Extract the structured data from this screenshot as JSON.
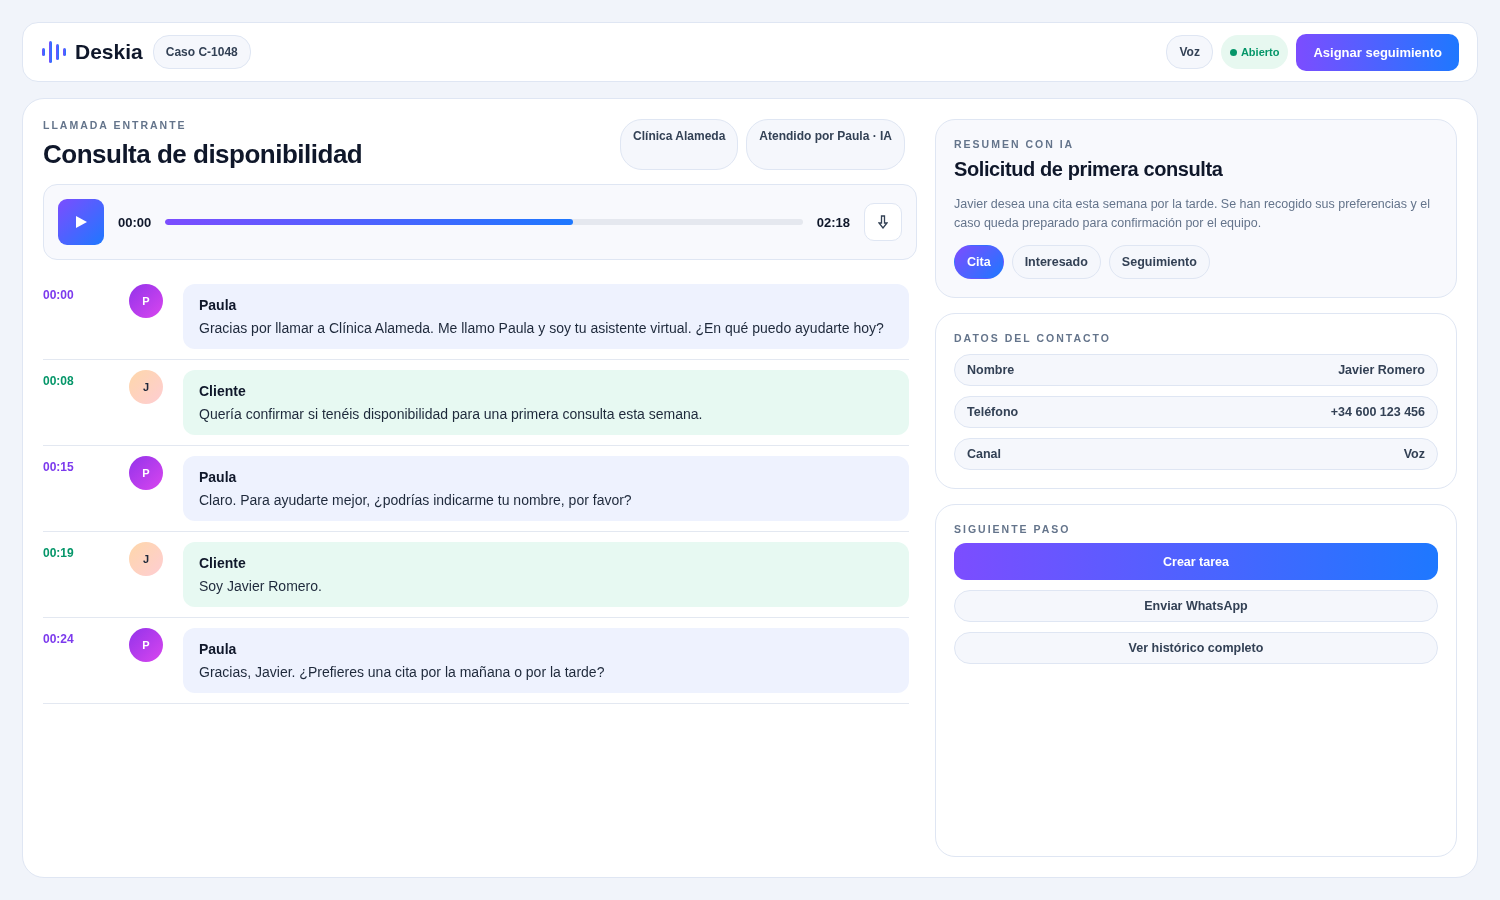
{
  "header": {
    "brand": "Deskia",
    "case": "Caso C-1048",
    "channel": "Voz",
    "status": {
      "label": "Abierto",
      "color": "#059669"
    },
    "primary_button": "Asignar seguimiento"
  },
  "call": {
    "eyebrow": "LLAMADA ENTRANTE",
    "title": "Consulta de disponibilidad",
    "chips": [
      "Clínica Alameda",
      "Atendido por Paula · IA"
    ],
    "player": {
      "current": "00:00",
      "duration": "02:18",
      "level": 0.64
    },
    "transcript": [
      {
        "time": "00:00",
        "kind": "agent",
        "initial": "P",
        "speaker": "Paula",
        "text": "Gracias por llamar a Clínica Alameda. Me llamo Paula y soy tu asistente virtual. ¿En qué puedo ayudarte hoy?"
      },
      {
        "time": "00:08",
        "kind": "client",
        "initial": "J",
        "speaker": "Cliente",
        "text": "Quería confirmar si tenéis disponibilidad para una primera consulta esta semana."
      },
      {
        "time": "00:15",
        "kind": "agent",
        "initial": "P",
        "speaker": "Paula",
        "text": "Claro. Para ayudarte mejor, ¿podrías indicarme tu nombre, por favor?"
      },
      {
        "time": "00:19",
        "kind": "client",
        "initial": "J",
        "speaker": "Cliente",
        "text": "Soy Javier Romero."
      },
      {
        "time": "00:24",
        "kind": "agent",
        "initial": "P",
        "speaker": "Paula",
        "text": "Gracias, Javier. ¿Prefieres una cita por la mañana o por la tarde?"
      }
    ]
  },
  "summary": {
    "eyebrow": "RESUMEN CON IA",
    "title": "Solicitud de primera consulta",
    "text": "Javier desea una cita esta semana por la tarde. Se han recogido sus preferencias y el caso queda preparado para confirmación por el equipo.",
    "tags": [
      {
        "label": "Cita",
        "selected": true
      },
      {
        "label": "Interesado",
        "selected": false
      },
      {
        "label": "Seguimiento",
        "selected": false
      }
    ]
  },
  "contact": {
    "eyebrow": "DATOS DEL CONTACTO",
    "fields": [
      {
        "label": "Nombre",
        "value": "Javier Romero"
      },
      {
        "label": "Teléfono",
        "value": "+34 600 123 456"
      },
      {
        "label": "Canal",
        "value": "Voz"
      }
    ]
  },
  "next_step": {
    "eyebrow": "SIGUIENTE PASO",
    "actions": [
      {
        "label": "Crear tarea",
        "kind": "primary"
      },
      {
        "label": "Enviar WhatsApp",
        "kind": "secondary"
      },
      {
        "label": "Ver histórico completo",
        "kind": "secondary"
      }
    ]
  }
}
